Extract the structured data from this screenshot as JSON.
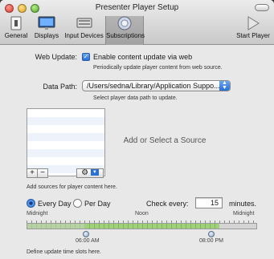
{
  "window": {
    "title": "Presenter Player Setup"
  },
  "toolbar": {
    "items": [
      {
        "label": "General",
        "icon": "general-icon"
      },
      {
        "label": "Displays",
        "icon": "display-icon"
      },
      {
        "label": "Input Devices",
        "icon": "input-devices-icon"
      },
      {
        "label": "Subscriptions",
        "icon": "subscriptions-icon",
        "selected": true
      }
    ],
    "start_label": "Start Player"
  },
  "web_update": {
    "label": "Web Update:",
    "checkbox_label": "Enable content update via web",
    "checked": true,
    "note": "Periodically update player content from web source."
  },
  "data_path": {
    "label": "Data Path:",
    "value": "/Users/sedna/Library/Application Suppo...",
    "note": "Select player data path to update."
  },
  "sources": {
    "placeholder": "Add or Select a Source",
    "add_label": "+",
    "remove_label": "−",
    "note": "Add sources for player content here."
  },
  "schedule": {
    "every_day_label": "Every Day",
    "per_day_label": "Per Day",
    "selected": "every_day",
    "check_every_label": "Check every:",
    "check_every_value": "15",
    "unit_label": "minutes.",
    "scale_start": "Midnight",
    "scale_mid": "Noon",
    "scale_end": "Midnight",
    "start_time": "06:00 AM",
    "end_time": "08:00 PM",
    "note": "Define update time slots here."
  },
  "colors": {
    "accent": "#2a6fd6",
    "slot_fill": "#9fd17a"
  }
}
